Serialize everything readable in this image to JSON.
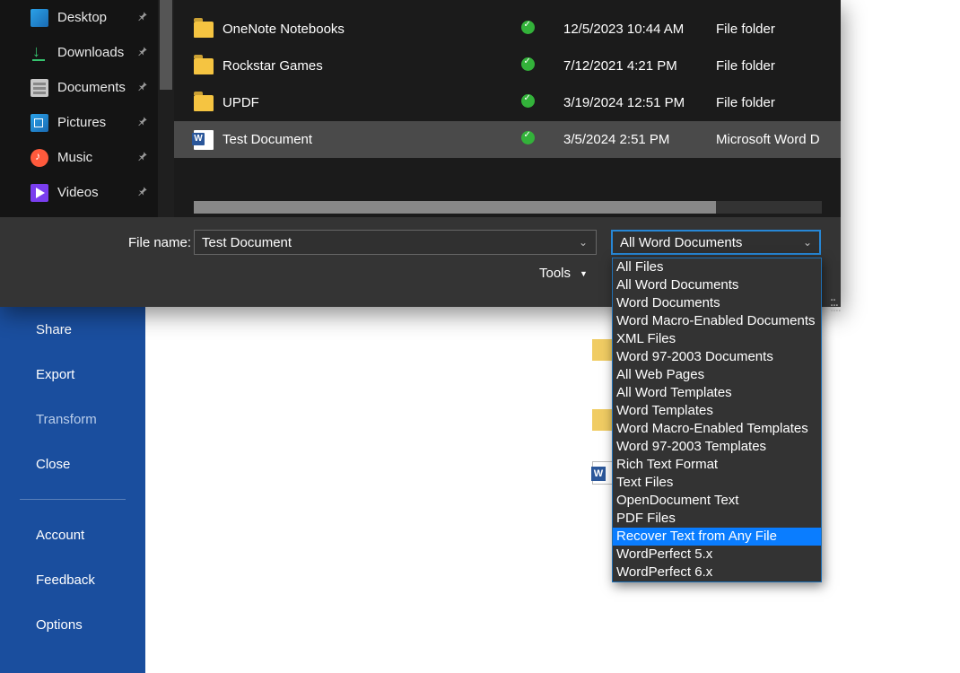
{
  "nav": [
    "Desktop",
    "Downloads",
    "Documents",
    "Pictures",
    "Music",
    "Videos"
  ],
  "files": [
    {
      "name": "OneNote Notebooks",
      "date": "12/5/2023 10:44 AM",
      "type": "File folder",
      "kind": "folder"
    },
    {
      "name": "Rockstar Games",
      "date": "7/12/2021 4:21 PM",
      "type": "File folder",
      "kind": "folder"
    },
    {
      "name": "UPDF",
      "date": "3/19/2024 12:51 PM",
      "type": "File folder",
      "kind": "folder"
    },
    {
      "name": "Test Document",
      "date": "3/5/2024 2:51 PM",
      "type": "Microsoft Word D",
      "kind": "word",
      "selected": true
    }
  ],
  "filename_label": "File name:",
  "filename_value": "Test Document",
  "file_type_selected": "All Word Documents",
  "tools_label": "Tools",
  "dropdown": [
    {
      "label": "All Files"
    },
    {
      "label": "All Word Documents"
    },
    {
      "label": "Word Documents"
    },
    {
      "label": "Word Macro-Enabled Documents"
    },
    {
      "label": "XML Files"
    },
    {
      "label": "Word 97-2003 Documents"
    },
    {
      "label": "All Web Pages"
    },
    {
      "label": "All Word Templates"
    },
    {
      "label": "Word Templates"
    },
    {
      "label": "Word Macro-Enabled Templates"
    },
    {
      "label": "Word 97-2003 Templates"
    },
    {
      "label": "Rich Text Format"
    },
    {
      "label": "Text Files"
    },
    {
      "label": "OpenDocument Text"
    },
    {
      "label": "PDF Files"
    },
    {
      "label": "Recover Text from Any File",
      "highlighted": true
    },
    {
      "label": "WordPerfect 5.x"
    },
    {
      "label": "WordPerfect 6.x"
    }
  ],
  "backstage": {
    "share": "Share",
    "export": "Export",
    "transform": "Transform",
    "close": "Close",
    "account": "Account",
    "feedback": "Feedback",
    "options": "Options"
  }
}
